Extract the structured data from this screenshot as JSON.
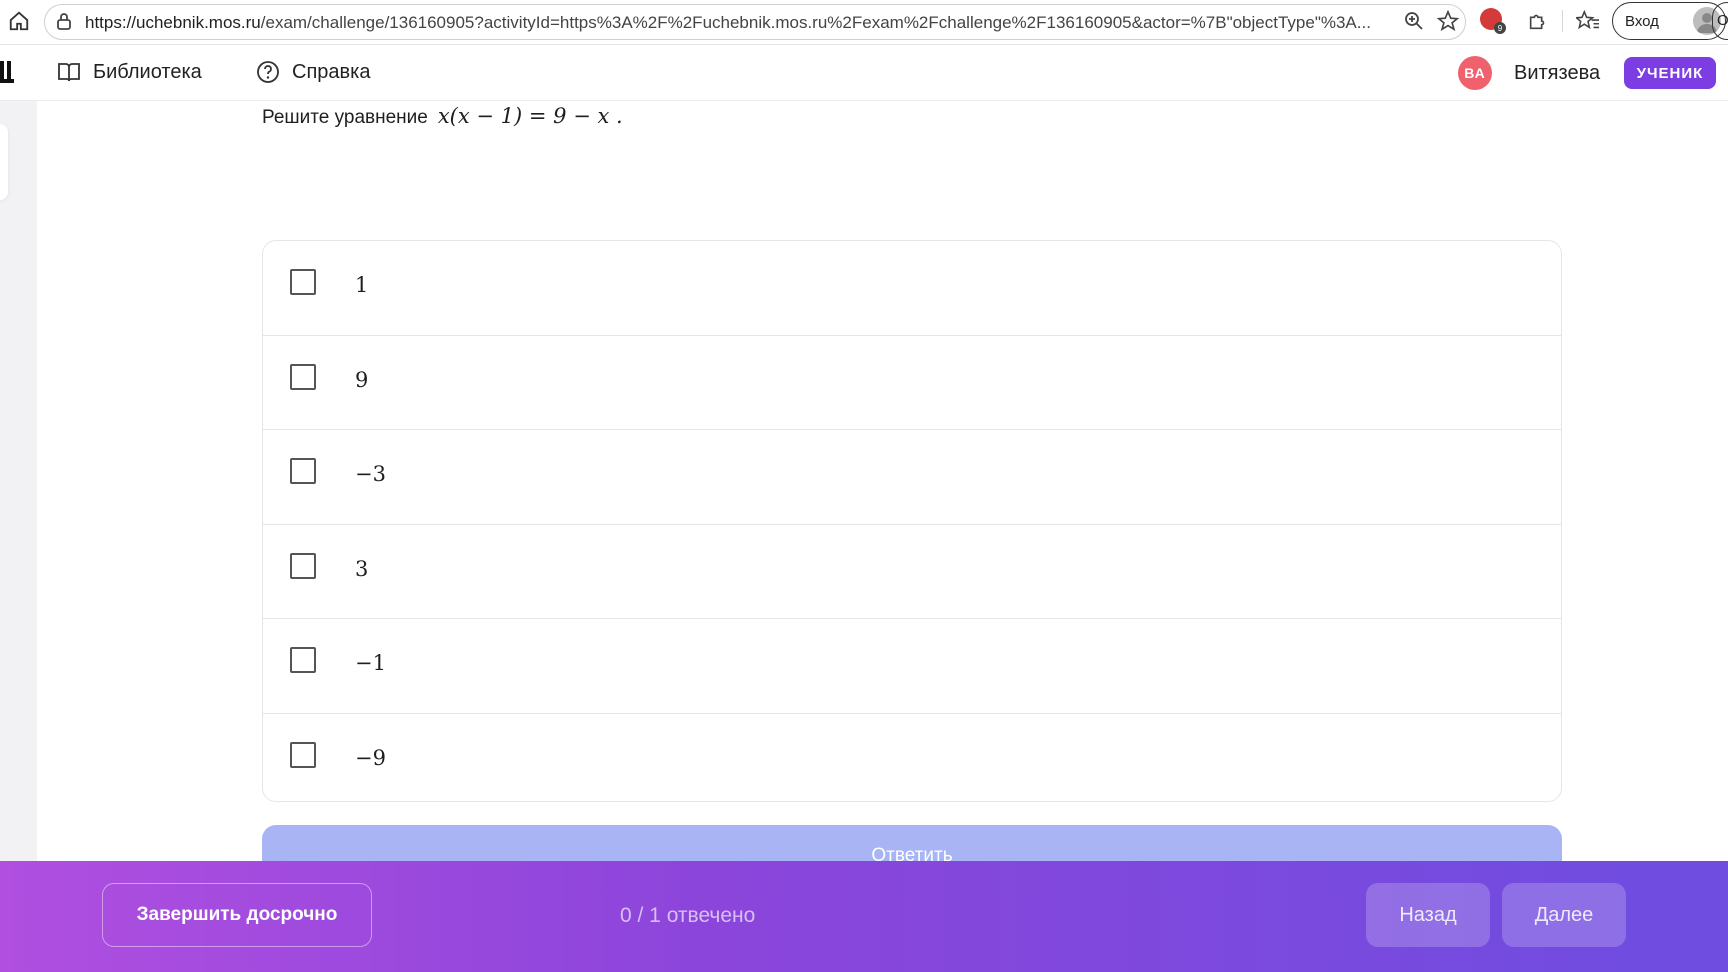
{
  "browser": {
    "url_host": "https://uchebnik.mos.ru",
    "url_rest": "/exam/challenge/136160905?activityId=https%3A%2F%2Fuchebnik.mos.ru%2Fexam%2Fchallenge%2F136160905&actor=%7B\"objectType\"%3A...",
    "login_label": "Вход",
    "cutoff_label": "Ос",
    "extension_badge": "9"
  },
  "nav": {
    "library_label": "Библиотека",
    "help_label": "Справка",
    "avatar_initials": "ВА",
    "user_name": "Витязева",
    "role_badge": "УЧЕНИК"
  },
  "question": {
    "prompt": "Решите уравнение",
    "equation": "x(x − 1) = 9 − x .",
    "options": [
      {
        "value": "1"
      },
      {
        "value": "9"
      },
      {
        "value": "−3"
      },
      {
        "value": "3"
      },
      {
        "value": "−1"
      },
      {
        "value": "−9"
      }
    ],
    "answer_label": "Ответить"
  },
  "footer": {
    "finish_label": "Завершить досрочно",
    "progress": "0 / 1 отвечено",
    "back_label": "Назад",
    "next_label": "Далее"
  },
  "colors": {
    "brand_purple": "#7c3de2",
    "avatar_red": "#f0616e",
    "answer_disabled": "#a9b4f5"
  }
}
